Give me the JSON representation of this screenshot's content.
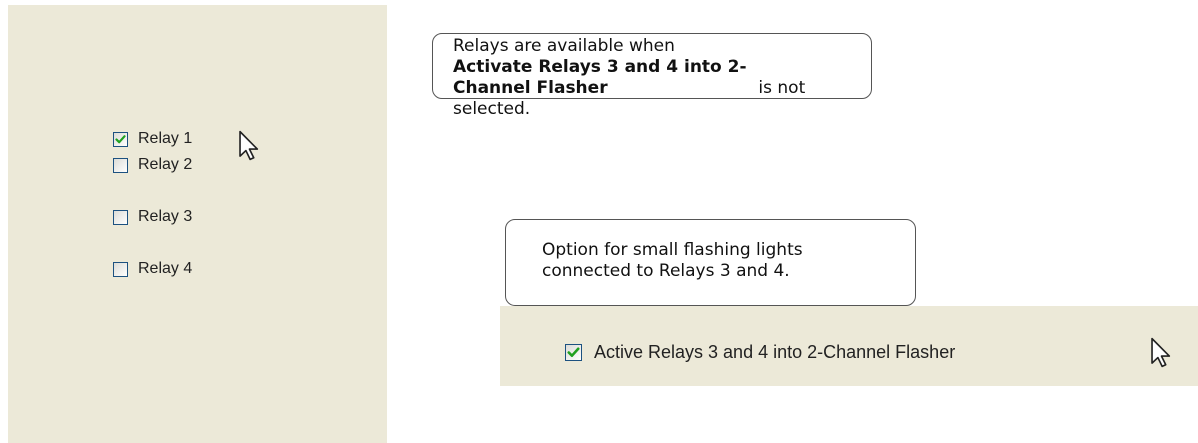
{
  "relay_panel": {
    "relays": [
      {
        "label": "Relay 1",
        "checked": true
      },
      {
        "label": "Relay 2",
        "checked": false
      },
      {
        "label": "Relay 3",
        "checked": false
      },
      {
        "label": "Relay 4",
        "checked": false
      }
    ]
  },
  "callout_relays": {
    "line1": "Relays are available when",
    "bold": "Activate Relays 3 and 4 into 2-Channel Flasher",
    "suffix": " is not selected."
  },
  "callout_flasher": {
    "line1": "Option for small flashing lights",
    "line2": "connected to Relays 3 and 4."
  },
  "flasher_option": {
    "label": "Active Relays 3 and 4 into 2-Channel Flasher",
    "checked": true
  },
  "colors": {
    "panel_background": "#ece9d8",
    "checkbox_border": "#1c5180",
    "check_mark": "#21a121"
  },
  "icons": {
    "cursor": "mouse-pointer-icon",
    "check": "check-mark-icon"
  }
}
